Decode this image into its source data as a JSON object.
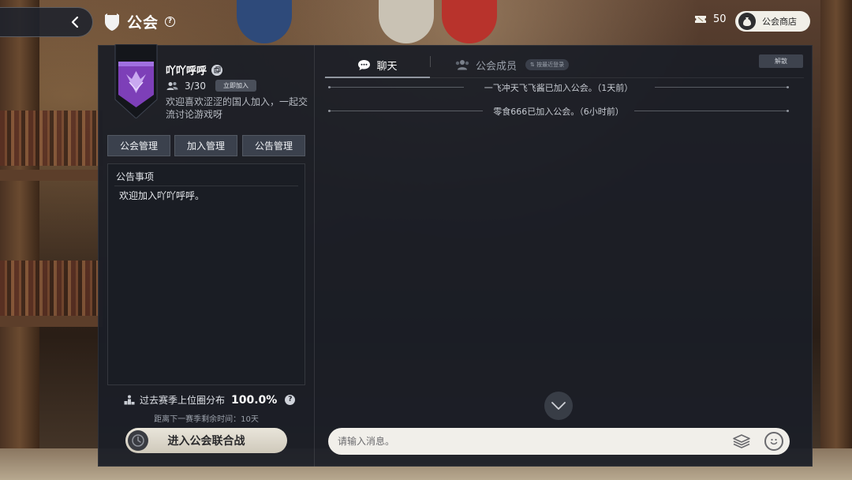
{
  "header": {
    "title": "公会",
    "help_symbol": "?",
    "currency_value": "50",
    "shop_label": "公会商店"
  },
  "guild": {
    "name": "吖吖呼呼",
    "member_count": "3/30",
    "join_badge": "立即加入",
    "description": "欢迎喜欢涩涩的国人加入，一起交流讨论游戏呀",
    "emblem_color": "#8a4ec8"
  },
  "management": {
    "buttons": [
      "公会管理",
      "加入管理",
      "公告管理"
    ]
  },
  "notice": {
    "title": "公告事项",
    "content": "欢迎加入吖吖呼呼。"
  },
  "season": {
    "label": "过去赛季上位圈分布",
    "percent": "100.0%",
    "help_symbol": "?",
    "remaining": "距离下一赛季剩余时间：10天",
    "enter_button": "进入公会联合战"
  },
  "tabs": {
    "chat": "聊天",
    "members": "公会成员",
    "sort_badge": "按最近登录",
    "disband": "解散"
  },
  "messages": [
    "一飞冲天飞飞酱已加入公会。（1天前）",
    "零食666已加入公会。（6小时前）"
  ],
  "chat_input": {
    "placeholder": "请输入消息。"
  },
  "icons": {
    "back": "chevron-left-icon",
    "title": "guild-shield-icon",
    "currency": "ticket-icon",
    "shop": "money-bag-icon",
    "copy": "copy-icon",
    "members": "people-icon",
    "rank": "podium-icon",
    "clock": "clock-icon",
    "chat": "chat-bubble-icon",
    "member_tab": "people-icon",
    "sort": "sort-arrows-icon",
    "scroll": "chevron-down-icon",
    "stack": "layers-icon",
    "emoji": "smile-icon"
  }
}
